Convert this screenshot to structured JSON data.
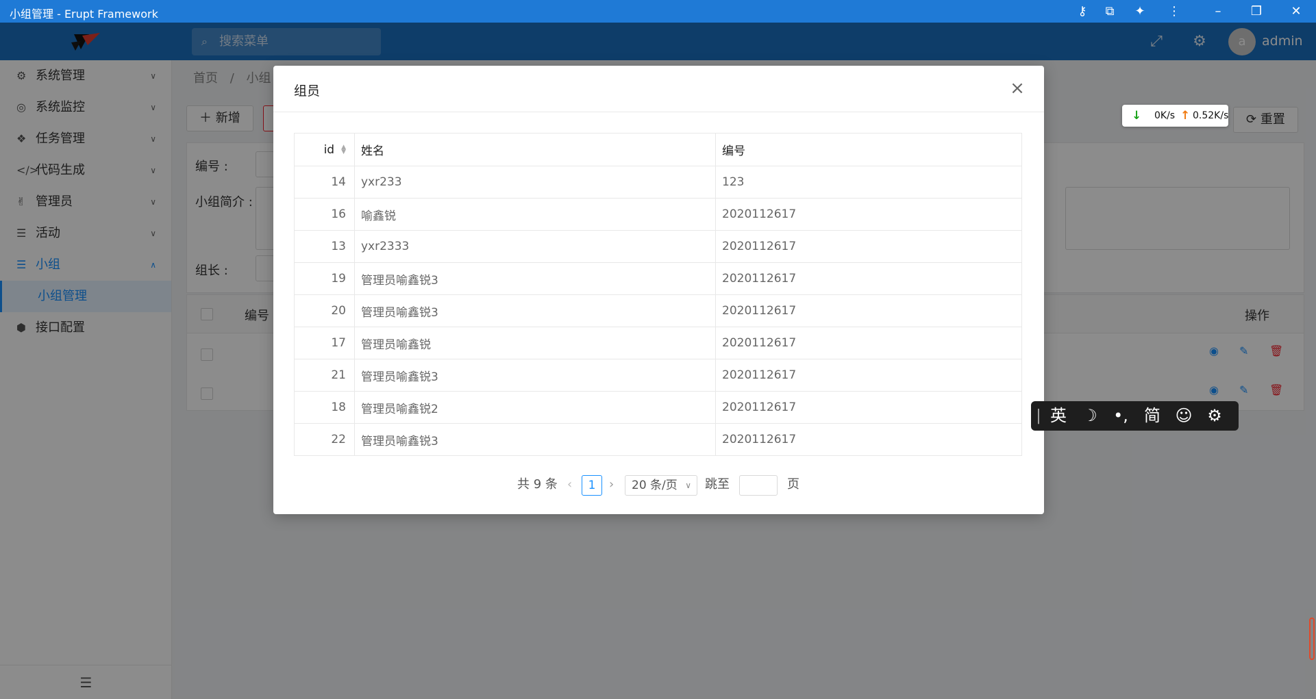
{
  "window": {
    "title": "小组管理 - Erupt Framework"
  },
  "header": {
    "search_placeholder": "搜索菜单",
    "username": "admin",
    "avatar_letter": "a"
  },
  "sidebar": {
    "items": [
      {
        "label": "系统管理",
        "icon": "gears-icon"
      },
      {
        "label": "系统监控",
        "icon": "target-icon"
      },
      {
        "label": "任务管理",
        "icon": "cubes-icon"
      },
      {
        "label": "代码生成",
        "icon": "code-icon"
      },
      {
        "label": "管理员",
        "icon": "hand-icon"
      },
      {
        "label": "活动",
        "icon": "list-icon"
      },
      {
        "label": "小组",
        "icon": "list-icon"
      },
      {
        "label": "小组管理",
        "icon": ""
      },
      {
        "label": "接口配置",
        "icon": "cube-icon"
      }
    ]
  },
  "background": {
    "breadcrumb": [
      "首页",
      "小组"
    ],
    "add_button": "新增",
    "reset_button": "重置",
    "form": {
      "code_label": "编号 :",
      "intro_label": "小组简介 :",
      "leader_label": "组长 :"
    },
    "table": {
      "code_header": "编号",
      "ops_header": "操作"
    }
  },
  "speed": {
    "down": "0K/s",
    "up": "0.52K/s"
  },
  "modal": {
    "title": "组员",
    "columns": [
      "id",
      "姓名",
      "编号"
    ],
    "rows": [
      {
        "id": "14",
        "name": "yxr233",
        "code": "123"
      },
      {
        "id": "16",
        "name": "喻鑫锐",
        "code": "2020112617"
      },
      {
        "id": "13",
        "name": "yxr2333",
        "code": "2020112617"
      },
      {
        "id": "19",
        "name": "管理员喻鑫锐3",
        "code": "2020112617"
      },
      {
        "id": "20",
        "name": "管理员喻鑫锐3",
        "code": "2020112617"
      },
      {
        "id": "17",
        "name": "管理员喻鑫锐",
        "code": "2020112617"
      },
      {
        "id": "21",
        "name": "管理员喻鑫锐3",
        "code": "2020112617"
      },
      {
        "id": "18",
        "name": "管理员喻鑫锐2",
        "code": "2020112617"
      },
      {
        "id": "22",
        "name": "管理员喻鑫锐3",
        "code": "2020112617"
      }
    ],
    "pager": {
      "total": "共 9 条",
      "current": "1",
      "page_size": "20 条/页",
      "jump_label": "跳至",
      "page_suffix": "页"
    }
  },
  "ime": {
    "lang": "英",
    "moon": "☽",
    "punct": "•,",
    "charset": "简",
    "emoji": "☺",
    "settings": "⚙"
  },
  "colors": {
    "titlebar": "#1f7ad6",
    "header": "#1b6fbf",
    "accent": "#1890ff",
    "danger": "#f5222d"
  }
}
